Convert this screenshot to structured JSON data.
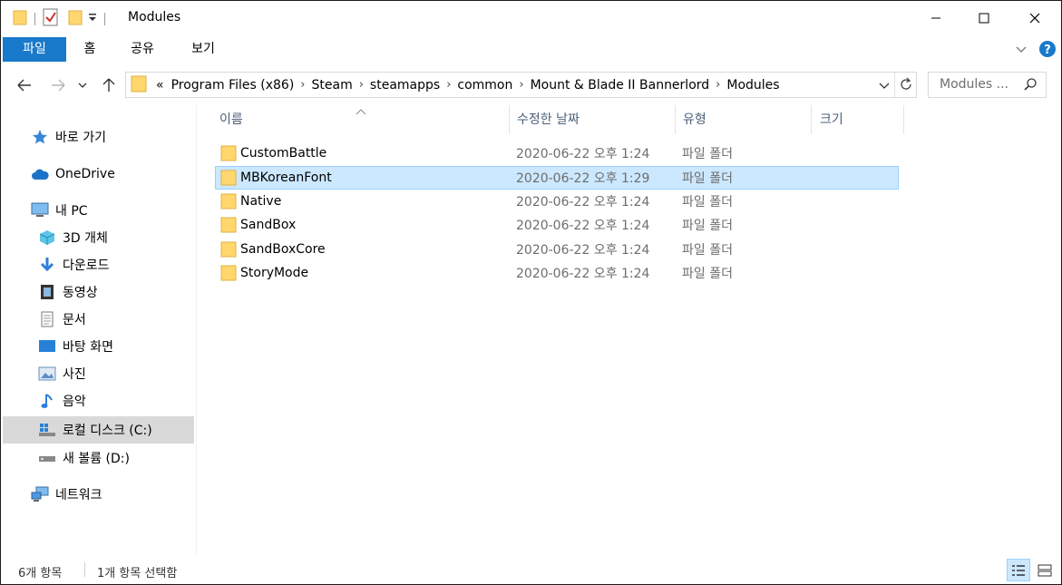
{
  "window": {
    "title": "Modules",
    "minimize_glyph": "—",
    "maximize_glyph": "☐",
    "close_glyph": "✕"
  },
  "ribbon": {
    "tabs": [
      {
        "label": "파일"
      },
      {
        "label": "홈"
      },
      {
        "label": "공유"
      },
      {
        "label": "보기"
      }
    ]
  },
  "address": {
    "overflow": "«",
    "crumbs": [
      "Program Files (x86)",
      "Steam",
      "steamapps",
      "common",
      "Mount & Blade II Bannerlord",
      "Modules"
    ],
    "separator": "›",
    "search_placeholder": "Modules ..."
  },
  "sidebar": {
    "items": [
      {
        "label": "바로 가기",
        "icon": "star-icon"
      },
      {
        "label": "OneDrive",
        "icon": "cloud-icon"
      },
      {
        "label": "내 PC",
        "icon": "pc-icon"
      },
      {
        "label": "3D 개체",
        "icon": "cube-icon"
      },
      {
        "label": "다운로드",
        "icon": "download-icon"
      },
      {
        "label": "동영상",
        "icon": "video-icon"
      },
      {
        "label": "문서",
        "icon": "document-icon"
      },
      {
        "label": "바탕 화면",
        "icon": "desktop-icon"
      },
      {
        "label": "사진",
        "icon": "pictures-icon"
      },
      {
        "label": "음악",
        "icon": "music-icon"
      },
      {
        "label": "로컬 디스크 (C:)",
        "icon": "drive-c-icon"
      },
      {
        "label": "새 볼륨 (D:)",
        "icon": "drive-d-icon"
      },
      {
        "label": "네트워크",
        "icon": "network-icon"
      }
    ]
  },
  "list": {
    "columns": {
      "name": "이름",
      "date": "수정한 날짜",
      "type": "유형",
      "size": "크기"
    },
    "rows": [
      {
        "name": "CustomBattle",
        "date": "2020-06-22 오후 1:24",
        "type": "파일 폴더"
      },
      {
        "name": "MBKoreanFont",
        "date": "2020-06-22 오후 1:29",
        "type": "파일 폴더"
      },
      {
        "name": "Native",
        "date": "2020-06-22 오후 1:24",
        "type": "파일 폴더"
      },
      {
        "name": "SandBox",
        "date": "2020-06-22 오후 1:24",
        "type": "파일 폴더"
      },
      {
        "name": "SandBoxCore",
        "date": "2020-06-22 오후 1:24",
        "type": "파일 폴더"
      },
      {
        "name": "StoryMode",
        "date": "2020-06-22 오후 1:24",
        "type": "파일 폴더"
      }
    ]
  },
  "status": {
    "item_count": "6개 항목",
    "selected": "1개 항목 선택함"
  },
  "colors": {
    "accent": "#1979ca",
    "selection": "#cce8ff",
    "folder": "#ffd76e"
  }
}
